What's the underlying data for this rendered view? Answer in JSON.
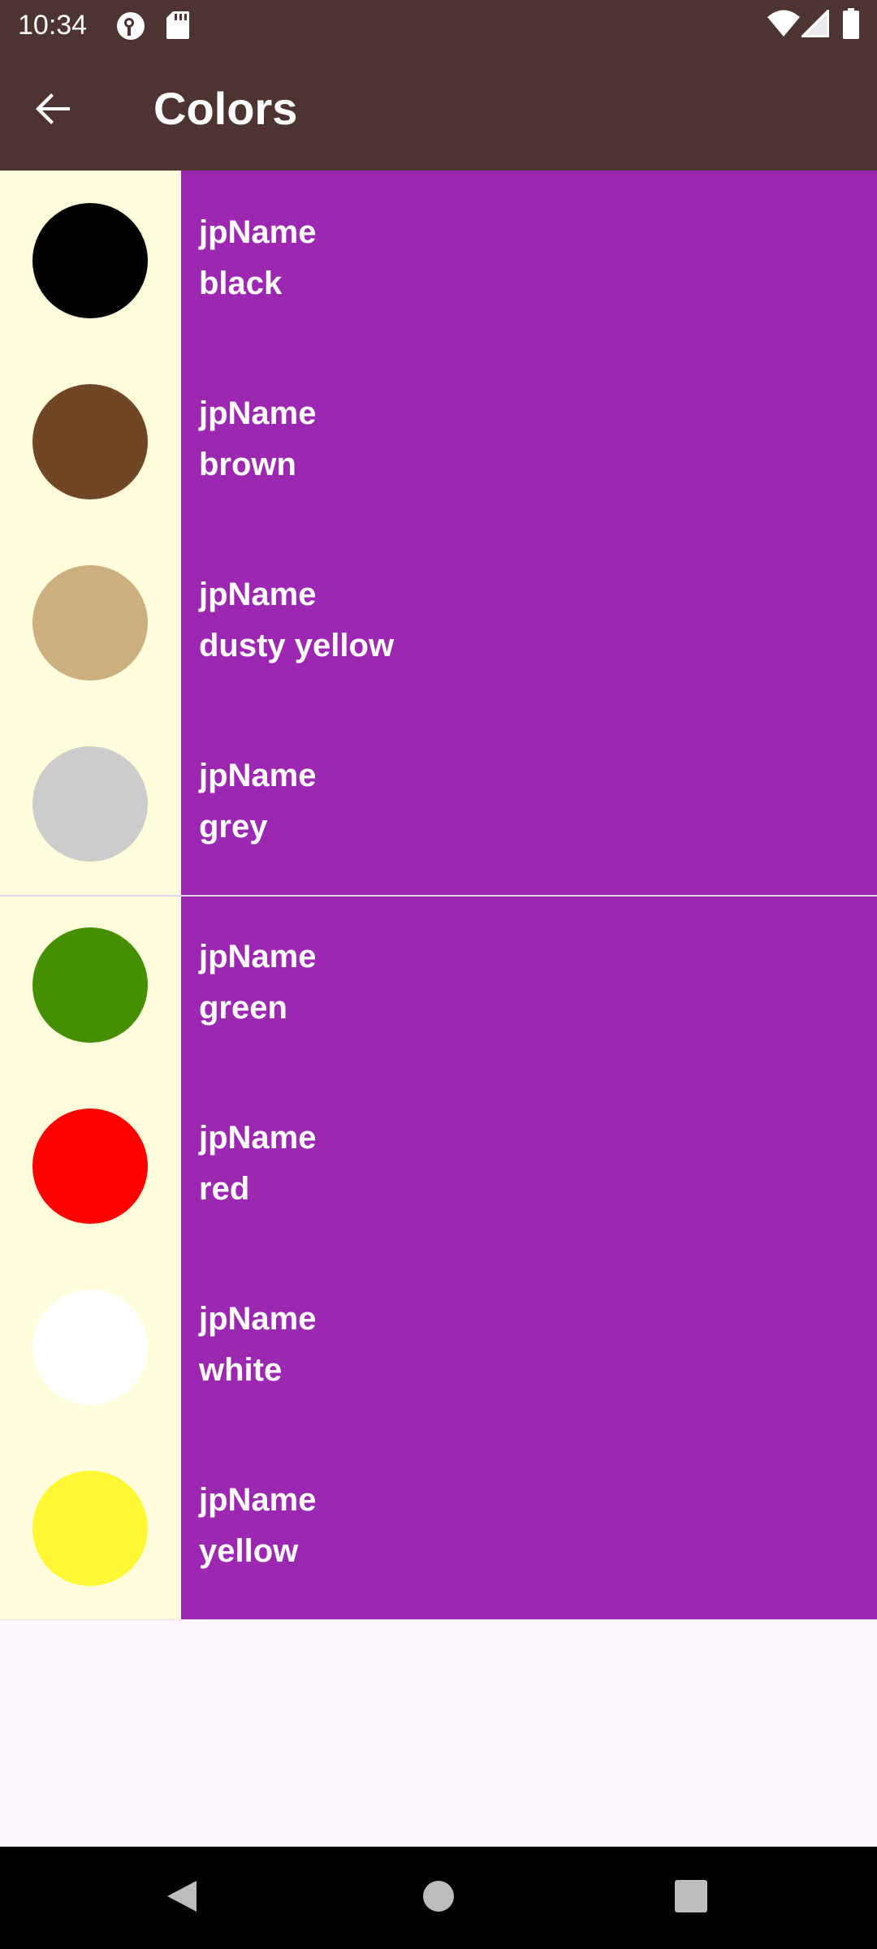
{
  "status_bar": {
    "time": "10:34",
    "icons": [
      "podcast-icon",
      "sd-card-icon",
      "wifi-icon",
      "signal-icon",
      "battery-icon"
    ]
  },
  "app_bar": {
    "title": "Colors",
    "back_icon": "arrow-back-icon",
    "background": "#4e3430"
  },
  "colors": [
    {
      "jp_name": "jpName",
      "en_name": "black",
      "swatch": "#000000"
    },
    {
      "jp_name": "jpName",
      "en_name": "brown",
      "swatch": "#6f4626"
    },
    {
      "jp_name": "jpName",
      "en_name": "dusty yellow",
      "swatch": "#cbaf7f"
    },
    {
      "jp_name": "jpName",
      "en_name": "grey",
      "swatch": "#cccccc"
    },
    {
      "jp_name": "jpName",
      "en_name": "green",
      "swatch": "#468f00"
    },
    {
      "jp_name": "jpName",
      "en_name": "red",
      "swatch": "#ff0000"
    },
    {
      "jp_name": "jpName",
      "en_name": "white",
      "swatch": "#ffffff"
    },
    {
      "jp_name": "jpName",
      "en_name": "yellow",
      "swatch": "#fff734"
    }
  ],
  "theme": {
    "swatch_background": "#fffddb",
    "item_background": "#9c27b0",
    "page_background": "#fdf7fd"
  },
  "nav_bar": {
    "buttons": [
      "nav-back-icon",
      "nav-home-icon",
      "nav-recents-icon"
    ]
  }
}
